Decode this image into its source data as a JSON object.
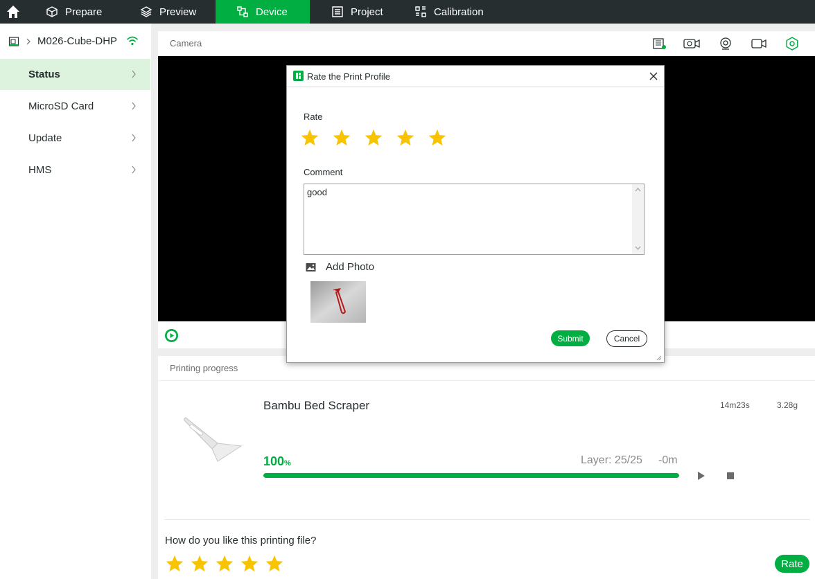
{
  "topbar": {
    "tabs": [
      {
        "label": "Prepare",
        "icon": "cube-icon"
      },
      {
        "label": "Preview",
        "icon": "layers-icon"
      },
      {
        "label": "Device",
        "icon": "device-icon"
      },
      {
        "label": "Project",
        "icon": "project-icon"
      },
      {
        "label": "Calibration",
        "icon": "calibration-icon"
      }
    ],
    "active_tab": "Device"
  },
  "sidebar": {
    "device_name": "M026-Cube-DHP",
    "items": [
      {
        "label": "Status"
      },
      {
        "label": "MicroSD Card"
      },
      {
        "label": "Update"
      },
      {
        "label": "HMS"
      }
    ],
    "active_item": "Status"
  },
  "camera": {
    "title": "Camera",
    "toolbar_icons": [
      "sd-card-icon",
      "camera-timelapse-icon",
      "webcam-icon",
      "video-record-icon",
      "settings-icon"
    ]
  },
  "progress": {
    "title": "Printing progress",
    "file_name": "Bambu Bed Scraper",
    "time": "14m23s",
    "weight": "3.28g",
    "percent_value": "100",
    "percent_sign": "%",
    "progress_fraction": 1.0,
    "layer_text": "Layer: 25/25",
    "remaining": "-0m"
  },
  "rating_prompt": {
    "question": "How do you like this printing file?",
    "stars_filled": 5,
    "stars_total": 5,
    "rate_button": "Rate"
  },
  "dialog": {
    "title": "Rate the Print Profile",
    "rate_label": "Rate",
    "stars_filled": 5,
    "stars_total": 5,
    "comment_label": "Comment",
    "comment_value": "good",
    "add_photo_label": "Add Photo",
    "submit_label": "Submit",
    "cancel_label": "Cancel"
  },
  "colors": {
    "accent": "#00ae42",
    "topbar": "#262e30",
    "star": "#f8c300"
  }
}
